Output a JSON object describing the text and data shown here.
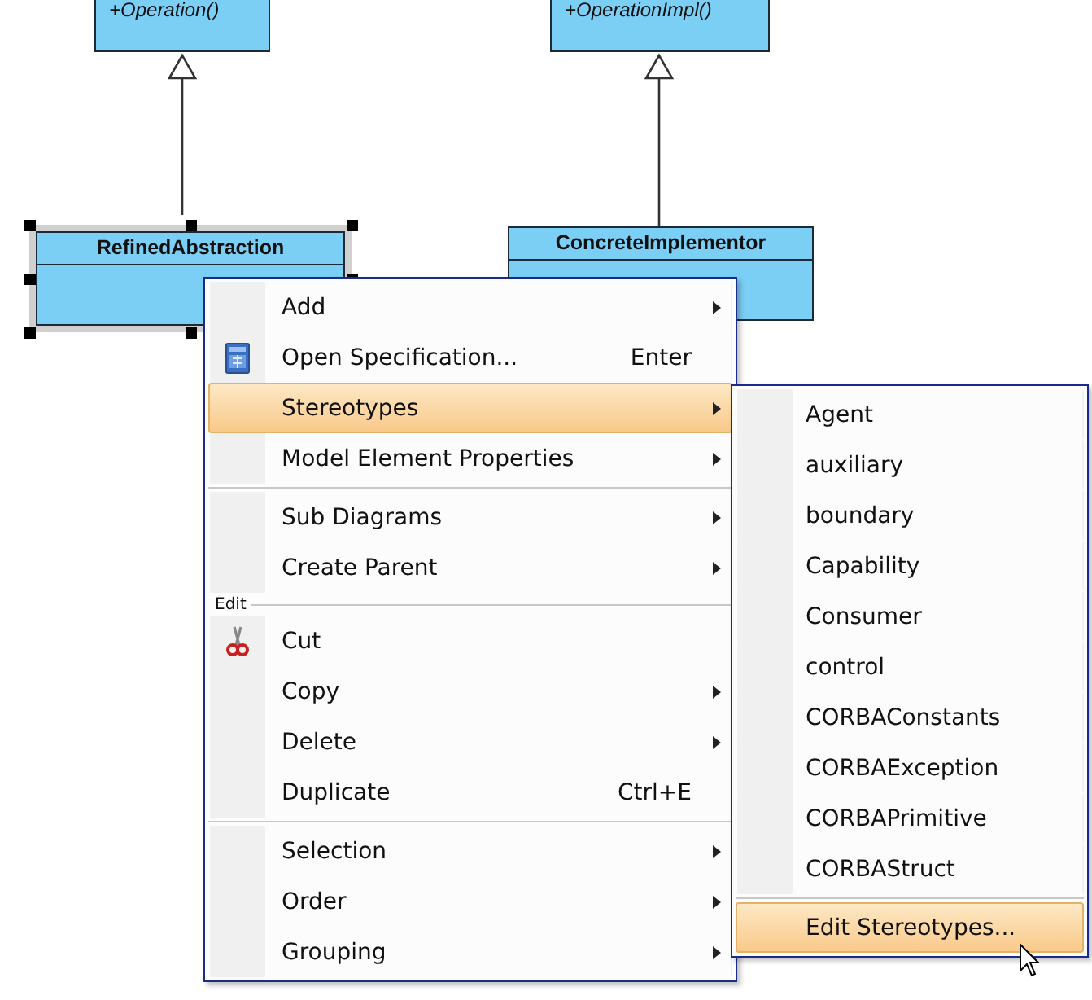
{
  "diagram": {
    "classes": [
      {
        "operations": [
          "+Operation()"
        ],
        "selected": false,
        "kind": "top"
      },
      {
        "operations": [
          "+OperationImpl()"
        ],
        "selected": false,
        "kind": "top"
      },
      {
        "name": "RefinedAbstraction",
        "selected": true,
        "kind": "main"
      },
      {
        "name": "ConcreteImplementor",
        "selected": false,
        "kind": "main"
      }
    ]
  },
  "context_menu": {
    "items": [
      {
        "kind": "item",
        "label": "Add",
        "submenu": true,
        "selected": false
      },
      {
        "kind": "spec",
        "label": "Open Specification...",
        "shortcut": "Enter",
        "submenu": false,
        "selected": false
      },
      {
        "kind": "item",
        "label": "Stereotypes",
        "submenu": true,
        "selected": true
      },
      {
        "kind": "item",
        "label": "Model Element Properties",
        "submenu": true,
        "selected": false
      },
      {
        "kind": "separator"
      },
      {
        "kind": "item",
        "label": "Sub Diagrams",
        "submenu": true,
        "selected": false
      },
      {
        "kind": "item",
        "label": "Create Parent",
        "submenu": true,
        "selected": false
      },
      {
        "kind": "group",
        "label": "Edit"
      },
      {
        "kind": "cut",
        "label": "Cut",
        "submenu": false,
        "selected": false
      },
      {
        "kind": "item",
        "label": "Copy",
        "submenu": true,
        "selected": false
      },
      {
        "kind": "item",
        "label": "Delete",
        "submenu": true,
        "selected": false
      },
      {
        "kind": "item",
        "label": "Duplicate",
        "shortcut": "Ctrl+E",
        "submenu": false,
        "selected": false
      },
      {
        "kind": "separator"
      },
      {
        "kind": "item",
        "label": "Selection",
        "submenu": true,
        "selected": false
      },
      {
        "kind": "item",
        "label": "Order",
        "submenu": true,
        "selected": false
      },
      {
        "kind": "item",
        "label": "Grouping",
        "submenu": true,
        "selected": false
      }
    ]
  },
  "submenu": {
    "items": [
      {
        "kind": "item",
        "label": "Agent",
        "selected": false
      },
      {
        "kind": "item",
        "label": "auxiliary",
        "selected": false
      },
      {
        "kind": "item",
        "label": "boundary",
        "selected": false
      },
      {
        "kind": "item",
        "label": "Capability",
        "selected": false
      },
      {
        "kind": "item",
        "label": "Consumer",
        "selected": false
      },
      {
        "kind": "item",
        "label": "control",
        "selected": false
      },
      {
        "kind": "item",
        "label": "CORBAConstants",
        "selected": false
      },
      {
        "kind": "item",
        "label": "CORBAException",
        "selected": false
      },
      {
        "kind": "item",
        "label": "CORBAPrimitive",
        "selected": false
      },
      {
        "kind": "item",
        "label": "CORBAStruct",
        "selected": false
      },
      {
        "kind": "separator"
      },
      {
        "kind": "item",
        "label": "Edit Stereotypes...",
        "selected": true
      }
    ]
  }
}
